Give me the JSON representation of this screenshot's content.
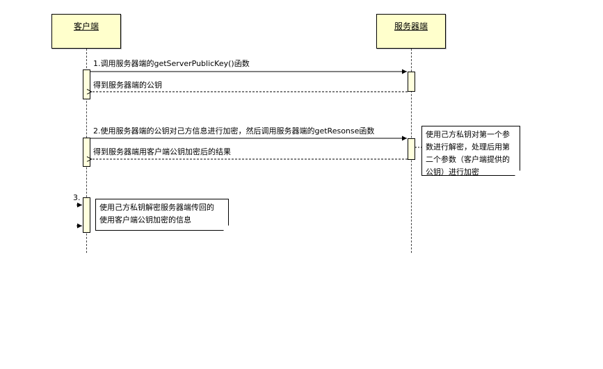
{
  "participants": {
    "client": "客户端",
    "server": "服务器端"
  },
  "messages": {
    "m1": "1.调用服务器端的getServerPublicKey()函数",
    "r1": "得到服务器端的公钥",
    "m2": "2.使用服务器端的公钥对己方信息进行加密，然后调用服务器端的getResonse函数",
    "r2": "得到服务器端用客户端公钥加密后的结果",
    "m3": "3."
  },
  "notes": {
    "server_note": [
      "使用己方私钥对第一个参",
      "数进行解密，处理后用第",
      "二个参数（客户端提供的",
      "公钥）进行加密"
    ],
    "client_note": [
      "使用己方私钥解密服务器端传回的",
      "使用客户端公钥加密的信息"
    ]
  }
}
